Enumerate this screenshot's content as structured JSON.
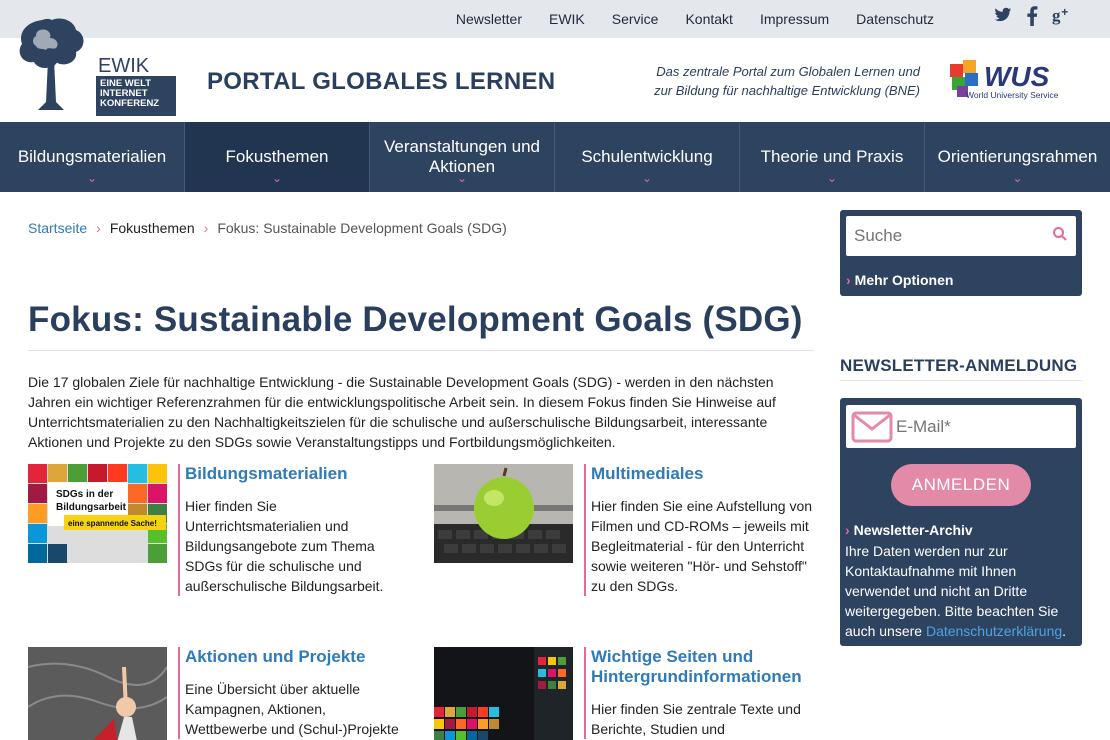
{
  "topnav": [
    "Newsletter",
    "EWIK",
    "Service",
    "Kontakt",
    "Impressum",
    "Datenschutz"
  ],
  "social": {
    "twitter": "twitter-icon",
    "facebook": "facebook-icon",
    "googleplus": "googleplus-icon"
  },
  "header": {
    "logo_text": [
      "EWIK",
      "EINE WELT",
      "INTERNET",
      "KONFERENZ"
    ],
    "title": "PORTAL GLOBALES LERNEN",
    "tagline_1": "Das zentrale Portal zum Globalen Lernen und",
    "tagline_2": "zur Bildung für nachhaltige Entwicklung (BNE)",
    "wus_logo": "WUS",
    "wus_sub": "World University Service"
  },
  "mainnav": [
    {
      "label": "Bildungsmaterialien",
      "active": false
    },
    {
      "label": "Fokusthemen",
      "active": true
    },
    {
      "label": "Veranstaltungen und Aktionen",
      "active": false
    },
    {
      "label": "Schulentwicklung",
      "active": false
    },
    {
      "label": "Theorie und Praxis",
      "active": false
    },
    {
      "label": "Orientierungsrahmen",
      "active": false
    }
  ],
  "breadcrumb": {
    "home": "Startseite",
    "parent": "Fokusthemen",
    "current": "Fokus: Sustainable Development Goals (SDG)"
  },
  "page": {
    "title": "Fokus: Sustainable Development Goals (SDG)",
    "intro": "Die 17 globalen Ziele für nachhaltige Entwicklung - die Sustainable Development Goals (SDG) - werden in den nächsten Jahren ein wichtiger Referenzrahmen für die entwicklungspolitische Arbeit sein. In diesem Fokus finden Sie Hinweise auf Unterrichtsmaterialien zu den Nachhaltigkeitszielen für die schulische und außerschulische Bildungsarbeit, interessante Aktionen und Projekte zu den SDGs sowie Veranstaltungstipps und Fortbildungsmöglichkeiten."
  },
  "cards": [
    {
      "title": "Bildungsmaterialien",
      "text": "Hier finden Sie Unterrichtsmaterialien und Bildungsangebote zum Thema SDGs für die schulische und außerschulische Bildungsarbeit.",
      "thumb_text_1": "SDGs in der",
      "thumb_text_2": "Bildungsarbeit",
      "thumb_text_3": "eine spannende Sache!"
    },
    {
      "title": "Multimediales",
      "text": "Hier finden Sie eine Aufstellung von Filmen und CD-ROMs – jeweils mit Begleitmaterial - für den Unterricht sowie weiteren \"Hör- und Sehstoff\" zu den SDGs."
    },
    {
      "title": "Aktionen und Projekte",
      "text": "Eine Übersicht über aktuelle Kampagnen, Aktionen, Wettbewerbe und (Schul-)Projekte"
    },
    {
      "title": "Wichtige Seiten und Hintergrundinformationen",
      "text": "Hier finden Sie zentrale Texte und Berichte, Studien und"
    }
  ],
  "sidebar": {
    "search_placeholder": "Suche",
    "more_options": "Mehr Optionen",
    "newsletter_heading": "NEWSLETTER-ANMELDUNG",
    "email_placeholder": "E-Mail*",
    "subscribe_label": "ANMELDEN",
    "archive_label": "Newsletter-Archiv",
    "info_text": "Ihre Daten werden nur zur Kontaktaufnahme mit Ihnen verwendet und nicht an Dritte weitergegeben. Bitte beachten Sie auch unsere ",
    "privacy_link": "Datenschutzerklärung",
    "info_end": "."
  },
  "colors": {
    "navy": "#2e4360",
    "pink": "#e46a96",
    "link": "#2f7ab8"
  }
}
